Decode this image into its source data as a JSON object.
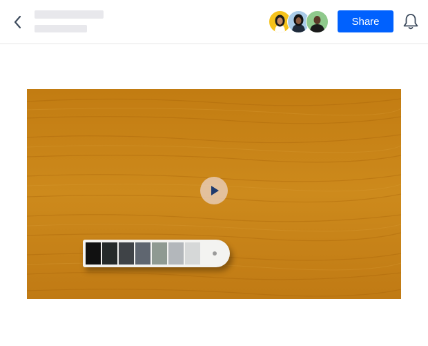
{
  "header": {
    "back_icon": "chevron-left-icon",
    "share_label": "Share",
    "notification_icon": "bell-icon",
    "collaborators": [
      {
        "ring_color": "#f5c21b"
      },
      {
        "ring_color": "#a9cbe8"
      },
      {
        "ring_color": "#8fc98c"
      }
    ],
    "accent_color": "#0061fe"
  },
  "video": {
    "background_color": "#c98416",
    "play_icon": "play-icon",
    "palette_swatches": [
      "#111111",
      "#252a2a",
      "#3f4347",
      "#5f6670",
      "#8f9a92",
      "#b3b7bb",
      "#d6d8d8"
    ]
  }
}
